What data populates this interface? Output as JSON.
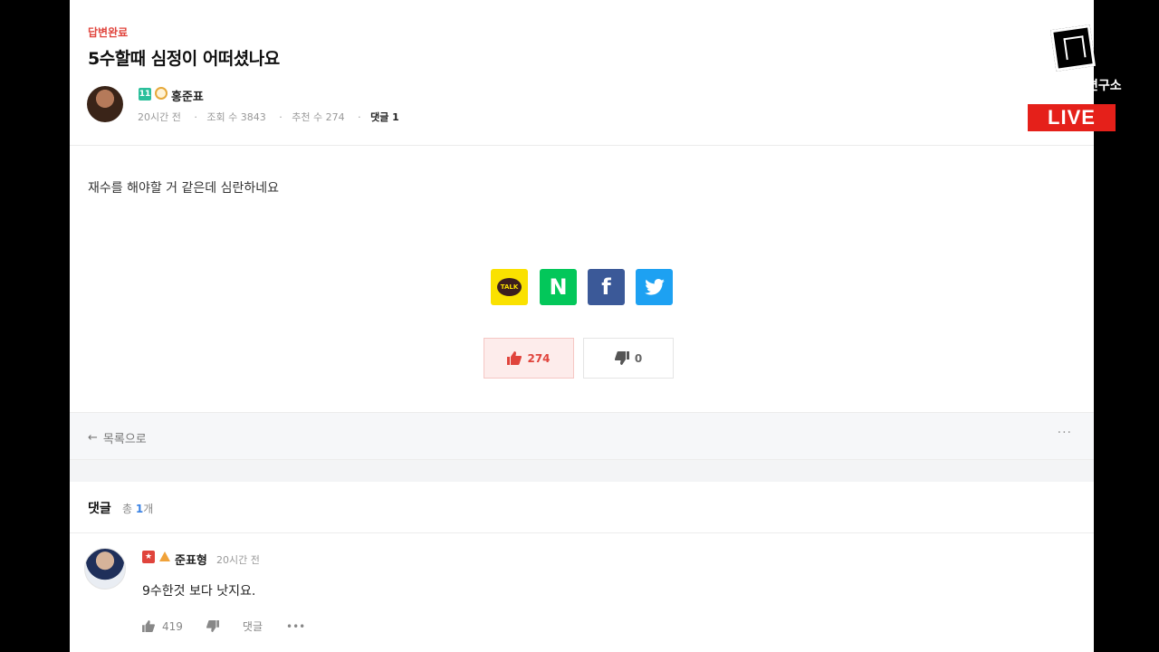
{
  "post": {
    "status": "답변완료",
    "title": "5수할때 심정이 어떠셨나요",
    "author": {
      "badge_text": "11",
      "name": "홍준표"
    },
    "meta": {
      "time": "20시간 전",
      "views_label": "조회 수 3843",
      "likes_label": "추천 수 274",
      "comments_label": "댓글 1"
    },
    "body": "재수를 해야할 거 같은데 심란하네요"
  },
  "share": {
    "kakao_label": "TALK",
    "naver_label": "N",
    "facebook_label": "f",
    "colors": {
      "kakao": "#fae100",
      "naver": "#03c75a",
      "facebook": "#3b5998",
      "twitter": "#1da1f2"
    }
  },
  "votes": {
    "up_count": "274",
    "down_count": "0"
  },
  "nav": {
    "back_label": "목록으로",
    "more_label": "···"
  },
  "comments": {
    "heading": "댓글",
    "total_prefix": "총 ",
    "total_count": "1",
    "total_suffix": "개",
    "items": [
      {
        "name": "준표형",
        "time": "20시간 전",
        "text": "9수한것 보다 낫지요.",
        "likes": "419",
        "reply_label": "댓글",
        "more_label": "•••"
      }
    ]
  },
  "overlay": {
    "channel_text": "연구소",
    "live_label": "LIVE"
  }
}
